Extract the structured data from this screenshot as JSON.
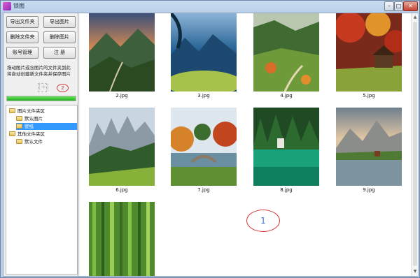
{
  "window": {
    "title": "锁图",
    "min_label": "–",
    "max_label": "□",
    "close_label": "✕"
  },
  "sidebar": {
    "buttons": {
      "export_folder": "导出文件夹",
      "export_image": "导出图片",
      "delete_folder": "删除文件夹",
      "delete_image": "删除图片",
      "account": "账号管理",
      "register": "注 册"
    },
    "hint_line1": "拖动图片或含图片的文件夹到此",
    "hint_line2": "将自动创建新文件夹并保存图片",
    "plus": "[+]",
    "annotation": "2",
    "progress": 1.0,
    "tree": [
      {
        "label": "图片文件夹区",
        "level": 0,
        "selected": false
      },
      {
        "label": "默认图片",
        "level": 1,
        "selected": false
      },
      {
        "label": "壁纸",
        "level": 1,
        "selected": true
      },
      {
        "label": "其他文件夹区",
        "level": 0,
        "selected": false
      },
      {
        "label": "默认文件",
        "level": 1,
        "selected": false
      }
    ]
  },
  "gallery": {
    "images": [
      {
        "caption": "2.jpg",
        "scene": "mountain-valley-sunset"
      },
      {
        "caption": "3.jpg",
        "scene": "blue-mountain-lake"
      },
      {
        "caption": "4.jpg",
        "scene": "autumn-hill-road"
      },
      {
        "caption": "5.jpg",
        "scene": "red-forest-cabin"
      },
      {
        "caption": "6.jpg",
        "scene": "alpine-meadow"
      },
      {
        "caption": "7.jpg",
        "scene": "autumn-park-bridge"
      },
      {
        "caption": "8.jpg",
        "scene": "green-lake-forest"
      },
      {
        "caption": "9.jpg",
        "scene": "mountain-lake-reflection"
      },
      {
        "caption": "",
        "scene": "bamboo-forest"
      }
    ],
    "annotation": "1"
  },
  "colors": {
    "selection": "#3399ff",
    "progress": "#20b41c",
    "annotation_ring": "#d43c3c"
  }
}
